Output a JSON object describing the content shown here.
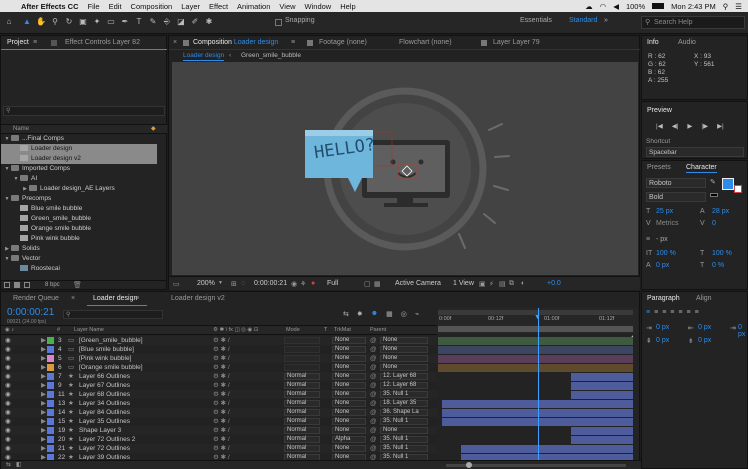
{
  "menubar": {
    "app": "After Effects CC",
    "items": [
      "File",
      "Edit",
      "Composition",
      "Layer",
      "Effect",
      "Animation",
      "View",
      "Window",
      "Help"
    ],
    "battery": "100%",
    "clock": "Mon 2:43 PM"
  },
  "toolbar": {
    "snapping": "Snapping",
    "workspaces": [
      "Essentials",
      "Standard"
    ],
    "search_placeholder": "Search Help"
  },
  "project": {
    "tab": "Project",
    "effects_tab": "Effect Controls Layer 82",
    "column_name": "Name",
    "bpc": "8 bpc",
    "items": [
      {
        "label": "...Final Comps",
        "indent": 0,
        "type": "folder",
        "twirl": "▼"
      },
      {
        "label": "Loader design",
        "indent": 1,
        "type": "comp",
        "sel": true
      },
      {
        "label": "Loader design v2",
        "indent": 1,
        "type": "comp",
        "sel": true
      },
      {
        "label": "Imported Comps",
        "indent": 0,
        "type": "folder",
        "twirl": "▼"
      },
      {
        "label": "AI",
        "indent": 1,
        "type": "folder",
        "twirl": "▼"
      },
      {
        "label": "Loader design_AE Layers",
        "indent": 2,
        "type": "folder",
        "twirl": "▶"
      },
      {
        "label": "Precomps",
        "indent": 0,
        "type": "folder",
        "twirl": "▼"
      },
      {
        "label": "Blue smile bubble",
        "indent": 1,
        "type": "comp"
      },
      {
        "label": "Green_smile_bubble",
        "indent": 1,
        "type": "comp"
      },
      {
        "label": "Orange smile bubble",
        "indent": 1,
        "type": "comp"
      },
      {
        "label": "Pink wink bubble",
        "indent": 1,
        "type": "comp"
      },
      {
        "label": "Solids",
        "indent": 0,
        "type": "folder",
        "twirl": "▶"
      },
      {
        "label": "Vector",
        "indent": 0,
        "type": "folder",
        "twirl": "▼"
      },
      {
        "label": "Roostecai",
        "indent": 1,
        "type": "img"
      }
    ]
  },
  "viewer": {
    "tabs": [
      "Composition Loader design",
      "Footage (none)",
      "Flowchart (none)",
      "Layer Layer 79"
    ],
    "comp_prefix": "Composition",
    "comp_name": "Loader design",
    "subtabs": [
      "Loader design",
      "Green_smile_bubble"
    ],
    "bubble_text": "HELLO?",
    "footer": {
      "zoom": "200%",
      "time": "0:00:00:21",
      "res": "Full",
      "camera": "Active Camera",
      "view": "1 View",
      "exposure": "+0.0"
    }
  },
  "info": {
    "tab": "Info",
    "audio_tab": "Audio",
    "r": "R : 62",
    "g": "G : 62",
    "b": "B : 62",
    "a": "A : 255",
    "x": "X : 93",
    "y": "Y : 561"
  },
  "preview": {
    "tab": "Preview",
    "shortcut_label": "Shortcut",
    "shortcut": "Spacebar"
  },
  "character": {
    "presets_tab": "Presets",
    "tab": "Character",
    "font": "Roboto",
    "style": "Bold",
    "size": "25 px",
    "leading": "28 px",
    "metrics": "Metrics",
    "tracking": "0",
    "units": "- px",
    "vscale": "100 %",
    "hscale": "100 %",
    "baseline": "0 px",
    "tsume": "0 %",
    "accent": "#2d8ceb"
  },
  "paragraph": {
    "tab": "Paragraph",
    "align_tab": "Align",
    "vals": [
      "0 px",
      "0 px",
      "0 px",
      "0 px",
      "0 px"
    ]
  },
  "timeline": {
    "render_tab": "Render Queue",
    "tab1": "Loader design",
    "tab2": "Loader design v2",
    "time": "0:00:00:21",
    "fps": "00021 (24.00 fps)",
    "headers": {
      "num": "#",
      "name": "Layer Name",
      "mode": "Mode",
      "t": "T",
      "trkmat": "TrkMat",
      "parent": "Parent"
    },
    "ruler": [
      "0:00f",
      "00:12f",
      "01:00f",
      "01:12f"
    ],
    "layers": [
      {
        "num": "3",
        "name": "[Green_smile_bubble]",
        "label": "#4cae4c",
        "mode": "",
        "trk": "None",
        "parent": "None",
        "bar": "#3f5a3f",
        "start": 0,
        "end": 1
      },
      {
        "num": "4",
        "name": "[Blue smile bubble]",
        "label": "#5b78d8",
        "mode": "",
        "trk": "None",
        "parent": "None",
        "bar": "#3d4660",
        "start": 0,
        "end": 1
      },
      {
        "num": "5",
        "name": "[Pink wink bubble]",
        "label": "#d784c8",
        "mode": "",
        "trk": "None",
        "parent": "None",
        "bar": "#5a3d58",
        "start": 0,
        "end": 1
      },
      {
        "num": "6",
        "name": "[Orange smile bubble]",
        "label": "#d99a3f",
        "mode": "",
        "trk": "None",
        "parent": "None",
        "bar": "#5e4a2d",
        "start": 0,
        "end": 1
      },
      {
        "num": "7",
        "name": "Layer 66 Outlines",
        "label": "#5b78d8",
        "mode": "Normal",
        "trk": "None",
        "parent": "12. Layer 68",
        "bar": "#4f5c9c",
        "start": 0.68,
        "end": 1
      },
      {
        "num": "9",
        "name": "Layer 67 Outlines",
        "label": "#5b78d8",
        "mode": "Normal",
        "trk": "None",
        "parent": "12. Layer 68",
        "bar": "#4f5c9c",
        "start": 0.68,
        "end": 1
      },
      {
        "num": "11",
        "name": "Layer 68 Outlines",
        "label": "#5b78d8",
        "mode": "Normal",
        "trk": "None",
        "parent": "35. Null 1",
        "bar": "#4f5c9c",
        "start": 0.68,
        "end": 1
      },
      {
        "num": "13",
        "name": "Layer 34 Outlines",
        "label": "#5b78d8",
        "mode": "Normal",
        "trk": "None",
        "parent": "18. Layer 35",
        "bar": "#4f5c9c",
        "start": 0.02,
        "end": 1
      },
      {
        "num": "14",
        "name": "Layer 84 Outlines",
        "label": "#5b78d8",
        "mode": "Normal",
        "trk": "None",
        "parent": "36. Shape La",
        "bar": "#4f5c9c",
        "start": 0.02,
        "end": 1
      },
      {
        "num": "15",
        "name": "Layer 35 Outlines",
        "label": "#5b78d8",
        "mode": "Normal",
        "trk": "None",
        "parent": "35. Null 1",
        "bar": "#4f5c9c",
        "start": 0.02,
        "end": 1
      },
      {
        "num": "19",
        "name": "Shape Layer 3",
        "label": "#5b78d8",
        "mode": "Normal",
        "trk": "None",
        "parent": "None",
        "bar": "#4f5c9c",
        "start": 0.68,
        "end": 1
      },
      {
        "num": "20",
        "name": "Layer 72 Outlines 2",
        "label": "#5b78d8",
        "mode": "Normal",
        "trk": "Alpha",
        "parent": "35. Null 1",
        "bar": "#4f5c9c",
        "start": 0.68,
        "end": 1
      },
      {
        "num": "21",
        "name": "Layer 72 Outlines",
        "label": "#5b78d8",
        "mode": "Normal",
        "trk": "None",
        "parent": "35. Null 1",
        "bar": "#4f5c9c",
        "start": 0.12,
        "end": 1
      },
      {
        "num": "22",
        "name": "Layer 39 Outlines",
        "label": "#5b78d8",
        "mode": "Normal",
        "trk": "None",
        "parent": "35. Null 1",
        "bar": "#4f5c9c",
        "start": 0.12,
        "end": 1
      }
    ]
  }
}
